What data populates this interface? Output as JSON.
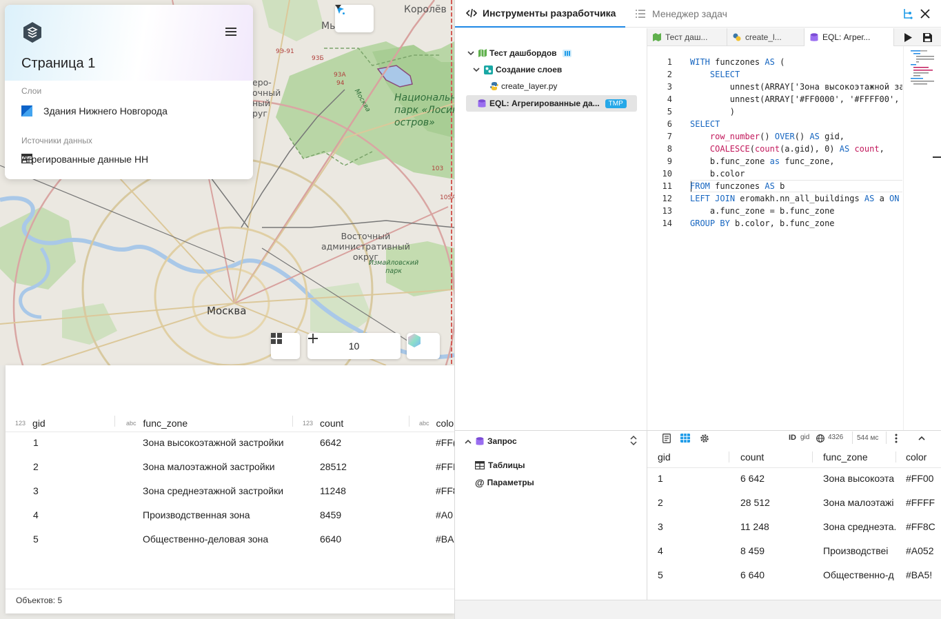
{
  "map": {
    "labels": {
      "korolev": "Королёв",
      "my": "Мы",
      "national_park": "Национальн\nпарк «Лосин\nостров»",
      "vostochny": "Восточный\nадминистративный\nокруг",
      "izmailovsky": "Измайловский\nпарк",
      "moskva": "Москва",
      "moskva_river": "Москва",
      "severo": "еро-\nочный\nный\nруг",
      "r9391": "9Э-91",
      "r93b": "93Б",
      "r93a": "93А",
      "r94": "94",
      "r103": "103",
      "r10sa": "10SA"
    },
    "zoom_value": "10",
    "icons": {
      "select": "cursor-select-icon",
      "grid": "grid-icon",
      "zoom_in": "plus-icon",
      "zoom_out": "minus-icon",
      "basemap": "basemap-icon"
    }
  },
  "page_card": {
    "title": "Страница 1",
    "layers_label": "Слои",
    "layer_name": "Здания Нижнего Новгорода",
    "sources_label": "Источники данных",
    "source_name": "Агрегированные данные НН"
  },
  "table": {
    "columns": [
      {
        "type": "123",
        "name": "gid"
      },
      {
        "type": "abc",
        "name": "func_zone"
      },
      {
        "type": "123",
        "name": "count"
      },
      {
        "type": "abc",
        "name": "colo"
      }
    ],
    "rows": [
      {
        "gid": "1",
        "func_zone": "Зона высокоэтажной застройки",
        "count": "6642",
        "color": "#FF("
      },
      {
        "gid": "2",
        "func_zone": "Зона малоэтажной застройки",
        "count": "28512",
        "color": "#FFI"
      },
      {
        "gid": "3",
        "func_zone": "Зона среднеэтажной застройки",
        "count": "11248",
        "color": "#FF8"
      },
      {
        "gid": "4",
        "func_zone": "Производственная зона",
        "count": "8459",
        "color": "#A0"
      },
      {
        "gid": "5",
        "func_zone": "Общественно-деловая зона",
        "count": "6640",
        "color": "#BA"
      }
    ],
    "footer": "Объектов: 5"
  },
  "devtools": {
    "tab_dev": "Инструменты разработчика",
    "tab_tasks": "Менеджер задач",
    "tree": {
      "root": "Тест дашбордов",
      "folder": "Создание слоев",
      "file_py": "create_layer.py",
      "file_eql": "EQL: Агрегированные да...",
      "tmp_badge": "TMP"
    },
    "editor_tabs": [
      "Тест даш...",
      "create_l...",
      "EQL: Агрег..."
    ],
    "code": [
      "WITH funczones AS (",
      "    SELECT",
      "        unnest(ARRAY['Зона высокоэтажной за",
      "        unnest(ARRAY['#FF0000', '#FFFF00',",
      "        )",
      "SELECT",
      "    row_number() OVER() AS gid,",
      "    COALESCE(count(a.gid), 0) AS count,",
      "    b.func_zone as func_zone,",
      "    b.color",
      "FROM funczones AS b",
      "LEFT JOIN eromakh.nn_all_buildings AS a ON",
      "    a.func_zone = b.func_zone",
      "GROUP BY b.color, b.func_zone"
    ],
    "query": {
      "title": "Запрос",
      "tables": "Таблицы",
      "params": "Параметры"
    },
    "result": {
      "id_label": "ID",
      "id_value": "gid",
      "srid": "4326",
      "time": "544 мс",
      "columns": [
        "gid",
        "count",
        "func_zone",
        "color"
      ],
      "rows": [
        [
          "1",
          "6 642",
          "Зона высокоэта",
          "#FF00"
        ],
        [
          "2",
          "28 512",
          "Зона малоэтажі",
          "#FFFF"
        ],
        [
          "3",
          "11 248",
          "Зона среднеэта.",
          "#FF8C"
        ],
        [
          "4",
          "8 459",
          "Производствеі",
          "#A052"
        ],
        [
          "5",
          "6 640",
          "Общественно-д",
          "#BA5!"
        ]
      ]
    }
  }
}
